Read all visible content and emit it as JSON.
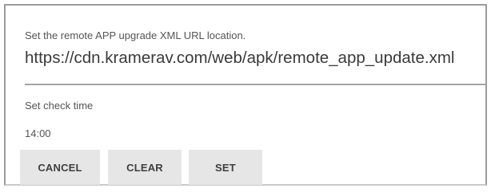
{
  "dialog": {
    "url_prompt": "Set the remote APP upgrade XML URL location.",
    "url_value": "https://cdn.kramerav.com/web/apk/remote_app_update.xml",
    "check_time_label": "Set check time",
    "check_time_value": "14:00"
  },
  "buttons": {
    "cancel": "CANCEL",
    "clear": "CLEAR",
    "set": "SET"
  }
}
